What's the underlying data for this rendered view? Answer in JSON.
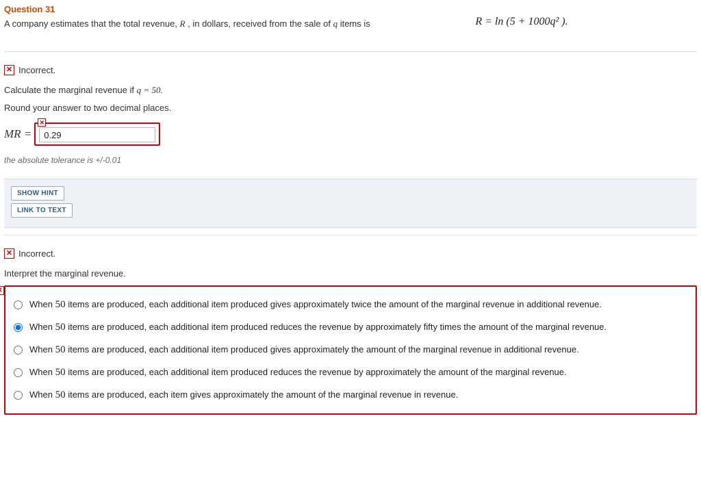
{
  "question": {
    "title": "Question 31",
    "intro_pre": "A company estimates that the total revenue, ",
    "intro_varR": "R",
    "intro_mid": ", in dollars, received from the sale of ",
    "intro_varq": "q",
    "intro_post": " items is",
    "formula": "R = ln (5 + 1000q² )."
  },
  "part1": {
    "feedback": "Incorrect.",
    "prompt_pre": "Calculate the marginal revenue if ",
    "prompt_eq": "q = 50.",
    "round_note": "Round your answer to two decimal places.",
    "mr_label": "MR =",
    "mr_value": "0.29",
    "tolerance": "the absolute tolerance is +/-0.01"
  },
  "hints": {
    "show_hint": "SHOW HINT",
    "link_to_text": "LINK TO TEXT"
  },
  "part2": {
    "feedback": "Incorrect.",
    "prompt": "Interpret the marginal revenue.",
    "num": "50",
    "options": [
      {
        "pre": "When ",
        "post": " items are produced, each additional item produced gives approximately twice the amount of the marginal revenue in additional revenue.",
        "selected": false
      },
      {
        "pre": "When ",
        "post": " items are produced, each additional item produced reduces the revenue by approximately fifty times the amount of the marginal revenue.",
        "selected": true
      },
      {
        "pre": "When ",
        "post": " items are produced, each additional item produced gives approximately the amount of the marginal revenue in additional revenue.",
        "selected": false
      },
      {
        "pre": "When ",
        "post": " items are produced, each additional item produced reduces the revenue by approximately the amount of the marginal revenue.",
        "selected": false
      },
      {
        "pre": "When ",
        "post": " items are produced, each item gives approximately the amount of the marginal revenue in revenue.",
        "selected": false
      }
    ]
  }
}
